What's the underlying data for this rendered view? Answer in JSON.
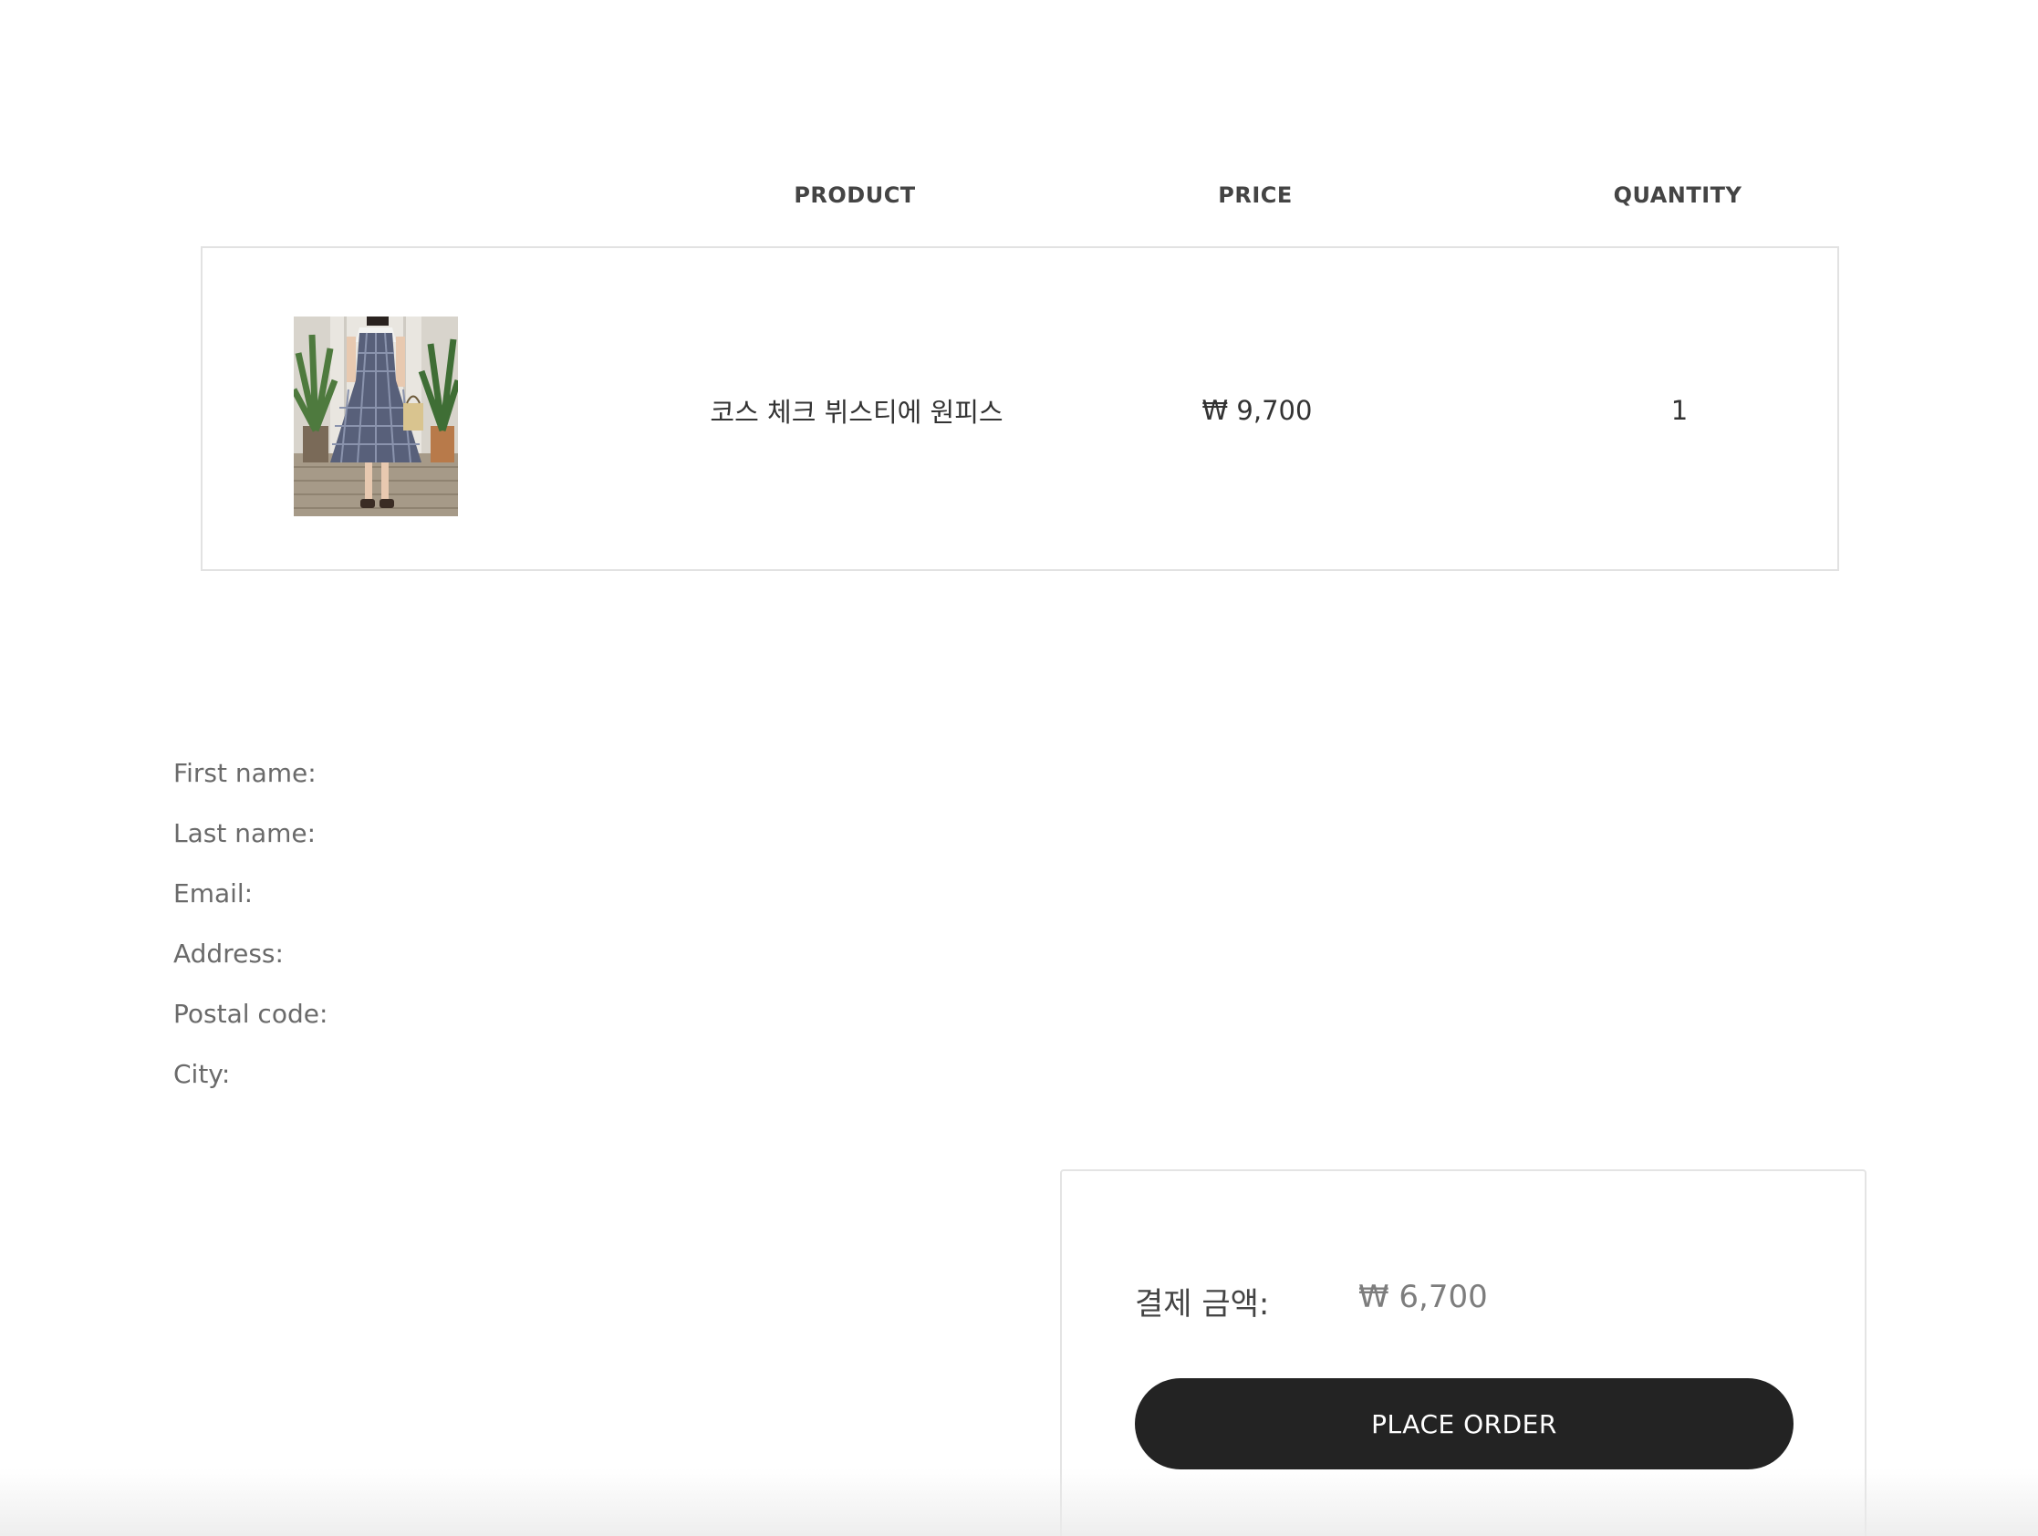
{
  "table": {
    "headers": {
      "product": "PRODUCT",
      "price": "PRICE",
      "quantity": "QUANTITY"
    },
    "items": [
      {
        "image_icon": "product-photo-plaid-dress",
        "name": "코스 체크 뷔스티에 원피스",
        "price": "₩ 9,700",
        "quantity": "1"
      }
    ]
  },
  "customer_info": {
    "first_name_label": "First name:",
    "last_name_label": "Last name:",
    "email_label": "Email:",
    "address_label": "Address:",
    "postal_code_label": "Postal code:",
    "city_label": "City:"
  },
  "summary": {
    "total_label": "결제 금액:",
    "total_value": "₩ 6,700",
    "place_order_label": "PLACE ORDER"
  },
  "colors": {
    "button_background": "#232323",
    "button_text": "#ffffff",
    "border": "#e2e2e2"
  }
}
